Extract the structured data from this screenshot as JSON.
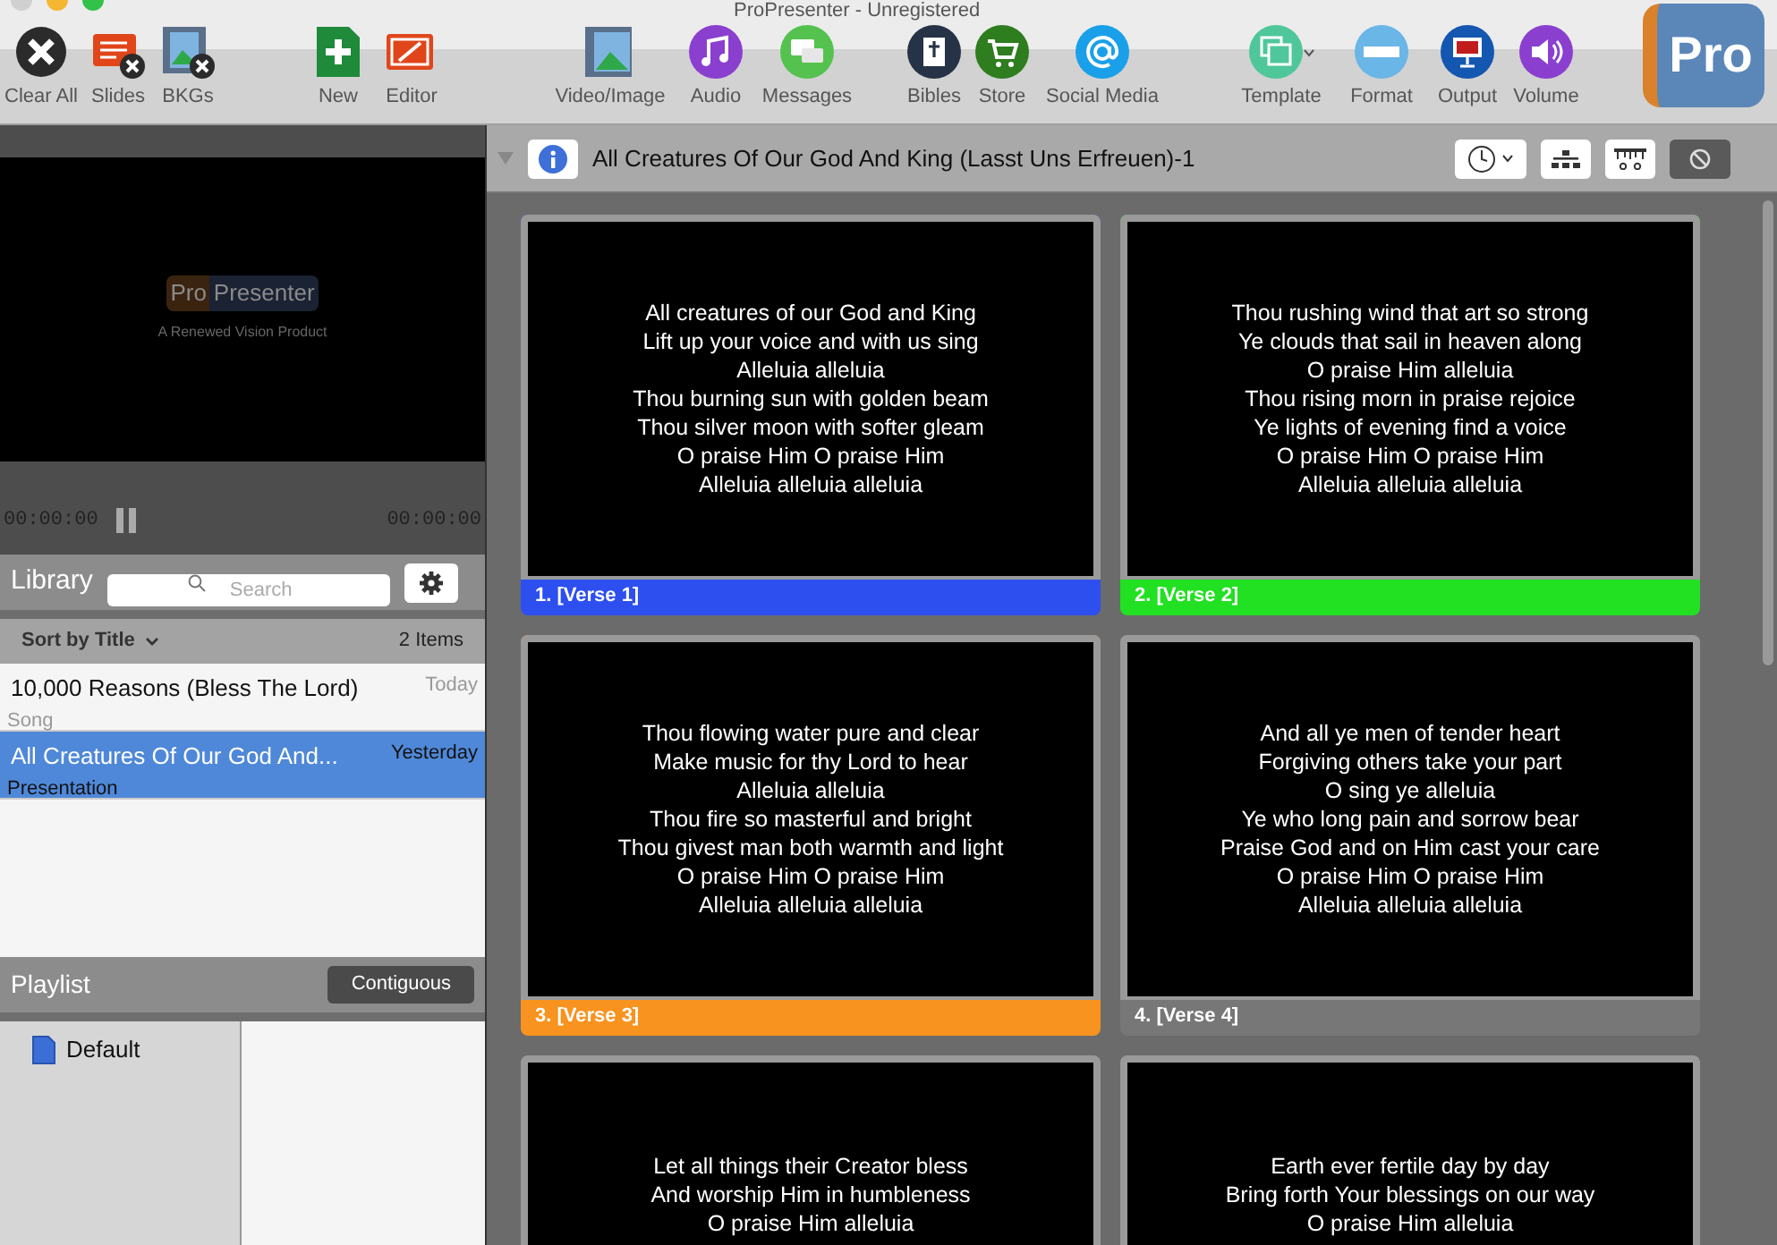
{
  "window": {
    "title": "ProPresenter - Unregistered"
  },
  "toolbar": {
    "groups": [
      [
        {
          "label": "Clear All"
        },
        {
          "label": "Slides"
        },
        {
          "label": "BKGs"
        }
      ],
      [
        {
          "label": "New"
        },
        {
          "label": "Editor"
        }
      ],
      [
        {
          "label": "Video/Image"
        },
        {
          "label": "Audio"
        },
        {
          "label": "Messages"
        }
      ],
      [
        {
          "label": "Bibles"
        },
        {
          "label": "Store"
        },
        {
          "label": "Social Media"
        }
      ],
      [
        {
          "label": "Template"
        },
        {
          "label": "Format"
        },
        {
          "label": "Output"
        },
        {
          "label": "Volume"
        }
      ]
    ],
    "logo": "Pro"
  },
  "preview": {
    "logo_left": "Pro",
    "logo_right": "Presenter",
    "tagline": "A Renewed Vision Product",
    "time_elapsed": "00:00:00",
    "time_remaining": "00:00:00"
  },
  "library": {
    "title": "Library",
    "search_placeholder": "Search",
    "sort": "Sort by Title",
    "count": "2 Items",
    "items": [
      {
        "title": "10,000 Reasons (Bless The Lord)",
        "date": "Today",
        "type": "Song",
        "selected": false
      },
      {
        "title": "All Creatures Of Our God And...",
        "date": "Yesterday",
        "type": "Presentation",
        "selected": true
      }
    ]
  },
  "playlist": {
    "title": "Playlist",
    "mode": "Contiguous",
    "items": [
      {
        "label": "Default"
      }
    ]
  },
  "presentation": {
    "title": "All Creatures Of Our God And King (Lasst Uns Erfreuen)-1",
    "slides": [
      {
        "label": "1. [Verse 1]",
        "color": "#2d4ff0",
        "lines": [
          "All creatures of our God and King",
          "Lift up your voice and with us sing",
          "Alleluia alleluia",
          "Thou burning sun with golden beam",
          "Thou silver moon with softer gleam",
          "O praise Him O praise Him",
          "Alleluia alleluia alleluia"
        ]
      },
      {
        "label": "2. [Verse 2]",
        "color": "#22e022",
        "lines": [
          "Thou rushing wind that art so strong",
          "Ye clouds that sail in heaven along",
          "O praise Him alleluia",
          "Thou rising morn in praise rejoice",
          "Ye lights of evening find a voice",
          "O praise Him O praise Him",
          "Alleluia alleluia alleluia"
        ]
      },
      {
        "label": "3. [Verse 3]",
        "color": "#f7931e",
        "lines": [
          "Thou flowing water pure and clear",
          "Make music for thy Lord to hear",
          "Alleluia alleluia",
          "Thou fire so masterful and bright",
          "Thou givest man both warmth and light",
          "O praise Him O praise Him",
          "Alleluia alleluia alleluia"
        ]
      },
      {
        "label": "4. [Verse 4]",
        "color": "#777777",
        "lines": [
          "And all ye men of tender heart",
          "Forgiving others take your part",
          "O sing ye alleluia",
          "Ye who long pain and sorrow bear",
          "Praise God and on Him cast your care",
          "O praise Him O praise Him",
          "Alleluia alleluia alleluia"
        ]
      },
      {
        "lines": [
          "Let all things their Creator bless",
          "And worship Him in humbleness",
          "O praise Him alleluia"
        ]
      },
      {
        "lines": [
          "Earth ever fertile day by day",
          "Bring forth Your blessings on our way",
          "O praise Him alleluia"
        ]
      }
    ]
  }
}
